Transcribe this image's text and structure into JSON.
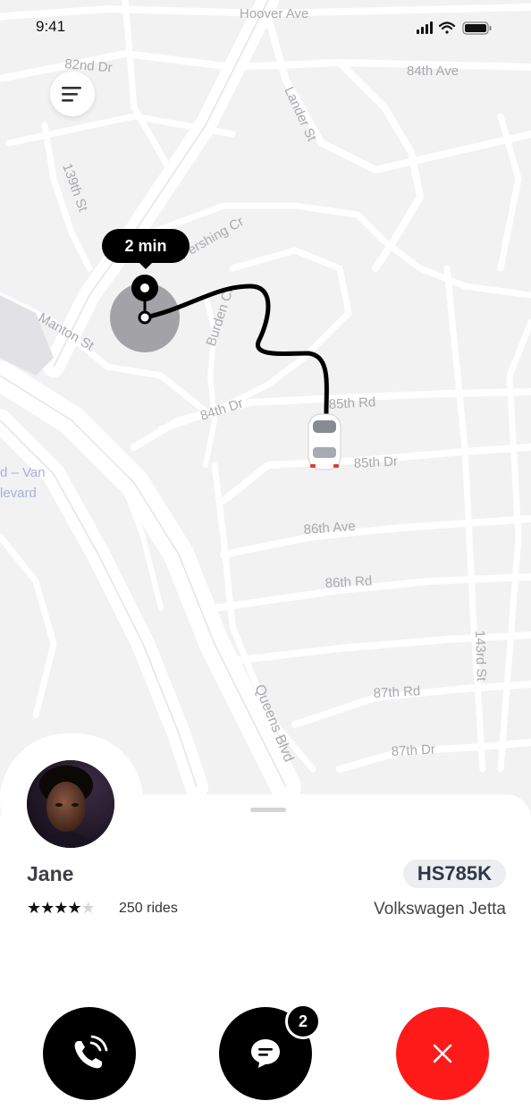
{
  "status_bar": {
    "time": "9:41"
  },
  "map": {
    "streets": [
      {
        "id": "hoover",
        "label": "Hoover Ave"
      },
      {
        "id": "82nd-dr",
        "label": "82nd Dr"
      },
      {
        "id": "84th-ave",
        "label": "84th Ave"
      },
      {
        "id": "lander",
        "label": "Lander St"
      },
      {
        "id": "139th",
        "label": "139th St"
      },
      {
        "id": "pershing",
        "label": "Pershing Cr"
      },
      {
        "id": "manton",
        "label": "Manton St"
      },
      {
        "id": "burden",
        "label": "Burden Cr"
      },
      {
        "id": "84th-dr",
        "label": "84th Dr"
      },
      {
        "id": "85th-rd",
        "label": "85th Rd"
      },
      {
        "id": "85th-dr",
        "label": "85th Dr"
      },
      {
        "id": "van-blvd-1",
        "label": "d – Van"
      },
      {
        "id": "van-blvd-2",
        "label": "levard"
      },
      {
        "id": "86th-ave",
        "label": "86th Ave"
      },
      {
        "id": "86th-rd",
        "label": "86th Rd"
      },
      {
        "id": "143rd",
        "label": "143rd St"
      },
      {
        "id": "87th-rd",
        "label": "87th Rd"
      },
      {
        "id": "87th-dr",
        "label": "87th Dr"
      },
      {
        "id": "queens",
        "label": "Queens Blvd"
      }
    ],
    "eta_label": "2 min"
  },
  "driver": {
    "name": "Jane",
    "rating": 4,
    "max_rating": 5,
    "rides": "250 rides",
    "plate": "HS785K",
    "car_model": "Volkswagen Jetta"
  },
  "actions": {
    "chat_badge": "2"
  },
  "colors": {
    "route": "#000000",
    "cancel": "#ff1a1a",
    "map_bg": "#f2f2f3",
    "road": "#ffffff"
  },
  "icons": [
    "menu-icon",
    "signal-icon",
    "wifi-icon",
    "battery-icon",
    "phone-icon",
    "chat-icon",
    "close-icon",
    "car-icon",
    "pickup-pin-icon"
  ]
}
